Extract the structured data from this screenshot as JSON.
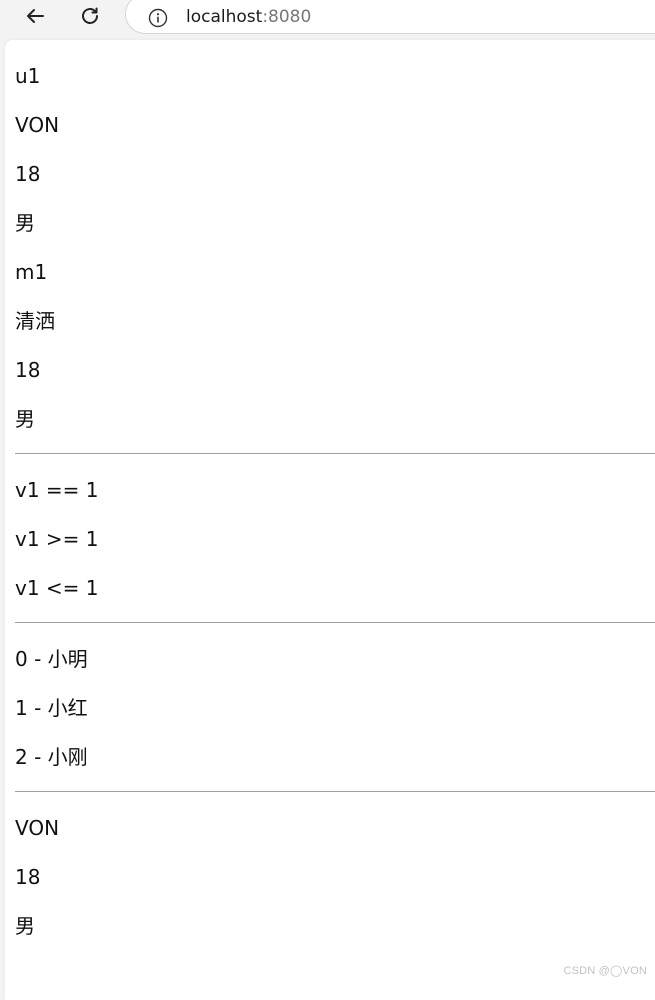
{
  "browser": {
    "url_host": "localhost",
    "url_port": ":8080"
  },
  "page": {
    "user_block": [
      "u1",
      "VON",
      "18",
      "男",
      "m1",
      "清洒",
      "18",
      "男"
    ],
    "compare_block": [
      "v1 == 1",
      "v1 >= 1",
      "v1 <= 1"
    ],
    "list_block": [
      "0 - 小明",
      "1 - 小红",
      "2 - 小刚"
    ],
    "last_block": [
      "VON",
      "18",
      "男"
    ]
  },
  "watermark": "CSDN @◯VON"
}
